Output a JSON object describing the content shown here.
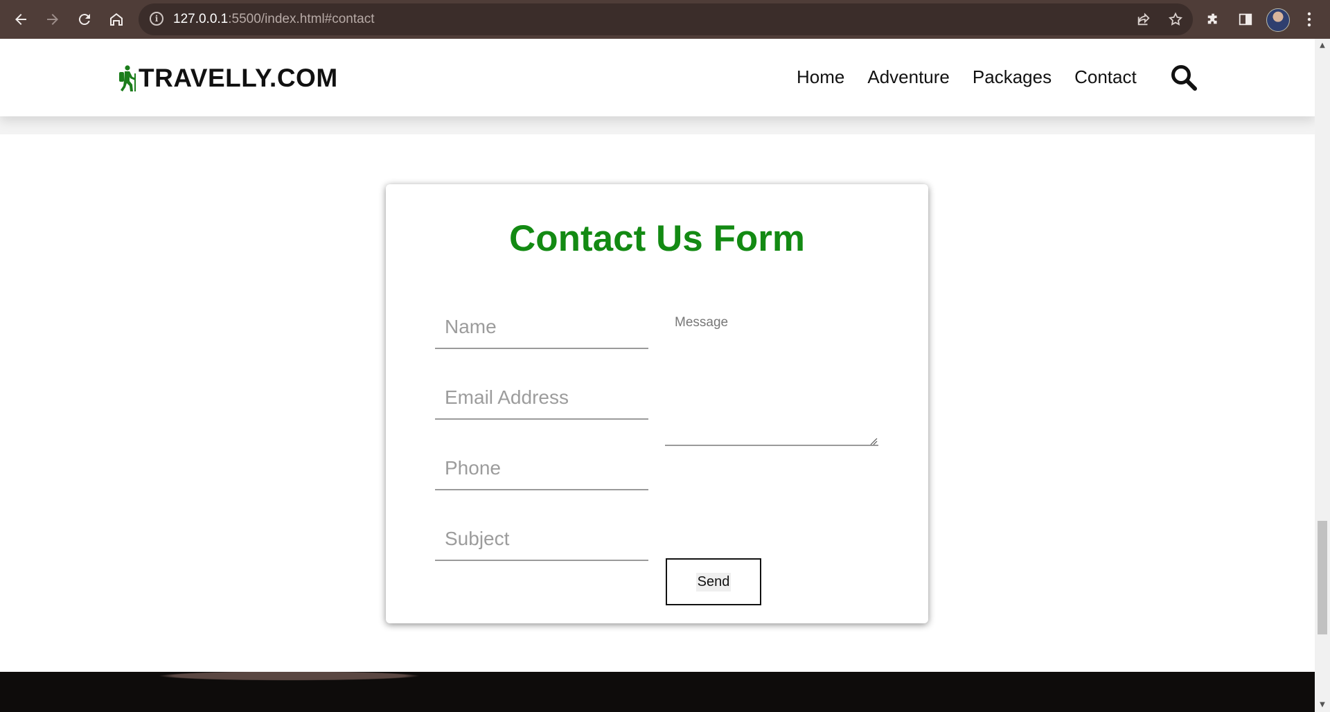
{
  "browser": {
    "url_host": "127.0.0.1",
    "url_rest": ":5500/index.html#contact"
  },
  "site": {
    "logo_text": "TRAVELLY.COM",
    "nav": [
      "Home",
      "Adventure",
      "Packages",
      "Contact"
    ],
    "brand_green": "#138a13"
  },
  "form": {
    "title": "Contact Us Form",
    "name_placeholder": "Name",
    "email_placeholder": "Email Address",
    "phone_placeholder": "Phone",
    "subject_placeholder": "Subject",
    "message_placeholder": "Message",
    "send_label": "Send"
  }
}
